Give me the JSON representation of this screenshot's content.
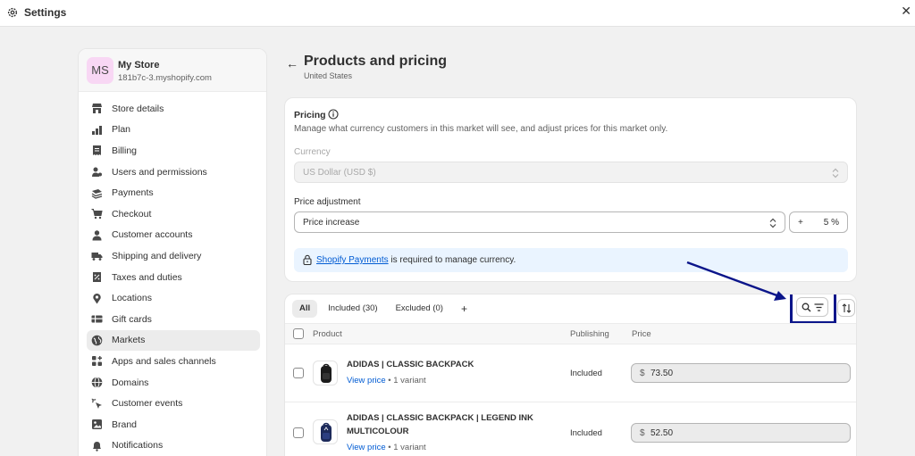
{
  "window": {
    "title": "Settings",
    "close_icon": "close-icon"
  },
  "store": {
    "initials": "MS",
    "name": "My Store",
    "domain": "181b7c-3.myshopify.com"
  },
  "sidebar": {
    "items": [
      {
        "label": "Store details",
        "icon": "store-icon"
      },
      {
        "label": "Plan",
        "icon": "plan-icon"
      },
      {
        "label": "Billing",
        "icon": "billing-icon"
      },
      {
        "label": "Users and permissions",
        "icon": "users-icon"
      },
      {
        "label": "Payments",
        "icon": "payments-icon"
      },
      {
        "label": "Checkout",
        "icon": "cart-icon"
      },
      {
        "label": "Customer accounts",
        "icon": "person-icon"
      },
      {
        "label": "Shipping and delivery",
        "icon": "truck-icon"
      },
      {
        "label": "Taxes and duties",
        "icon": "tax-icon"
      },
      {
        "label": "Locations",
        "icon": "location-icon"
      },
      {
        "label": "Gift cards",
        "icon": "gift-card-icon"
      },
      {
        "label": "Markets",
        "icon": "globe-icon",
        "active": true
      },
      {
        "label": "Apps and sales channels",
        "icon": "apps-icon"
      },
      {
        "label": "Domains",
        "icon": "domains-icon"
      },
      {
        "label": "Customer events",
        "icon": "events-icon"
      },
      {
        "label": "Brand",
        "icon": "brand-icon"
      },
      {
        "label": "Notifications",
        "icon": "bell-icon"
      }
    ]
  },
  "page": {
    "title": "Products and pricing",
    "subtitle": "United States"
  },
  "pricing": {
    "heading": "Pricing",
    "description": "Manage what currency customers in this market will see, and adjust prices for this market only.",
    "currency_label": "Currency",
    "currency_value": "US Dollar (USD $)",
    "adjustment_label": "Price adjustment",
    "adjustment_value": "Price increase",
    "adjustment_sign": "+",
    "adjustment_percent": "5 %",
    "banner_link": "Shopify Payments",
    "banner_text": " is required to manage currency."
  },
  "products": {
    "tabs": [
      {
        "label": "All",
        "active": true
      },
      {
        "label": "Included (30)"
      },
      {
        "label": "Excluded (0)"
      },
      {
        "label": "+"
      }
    ],
    "columns": {
      "product": "Product",
      "publishing": "Publishing",
      "price": "Price"
    },
    "rows": [
      {
        "name": "ADIDAS | CLASSIC BACKPACK",
        "view_price": "View price",
        "variants": " • 1 variant",
        "publishing": "Included",
        "currency": "$",
        "price": "73.50"
      },
      {
        "name": "ADIDAS | CLASSIC BACKPACK | LEGEND INK MULTICOLOUR",
        "view_price": "View price",
        "variants": " • 1 variant",
        "publishing": "Included",
        "currency": "$",
        "price": "52.50"
      }
    ]
  },
  "colors": {
    "accent_link": "#005bd3",
    "highlight_box": "#0b158a",
    "avatar_bg": "#f8d7f4"
  }
}
